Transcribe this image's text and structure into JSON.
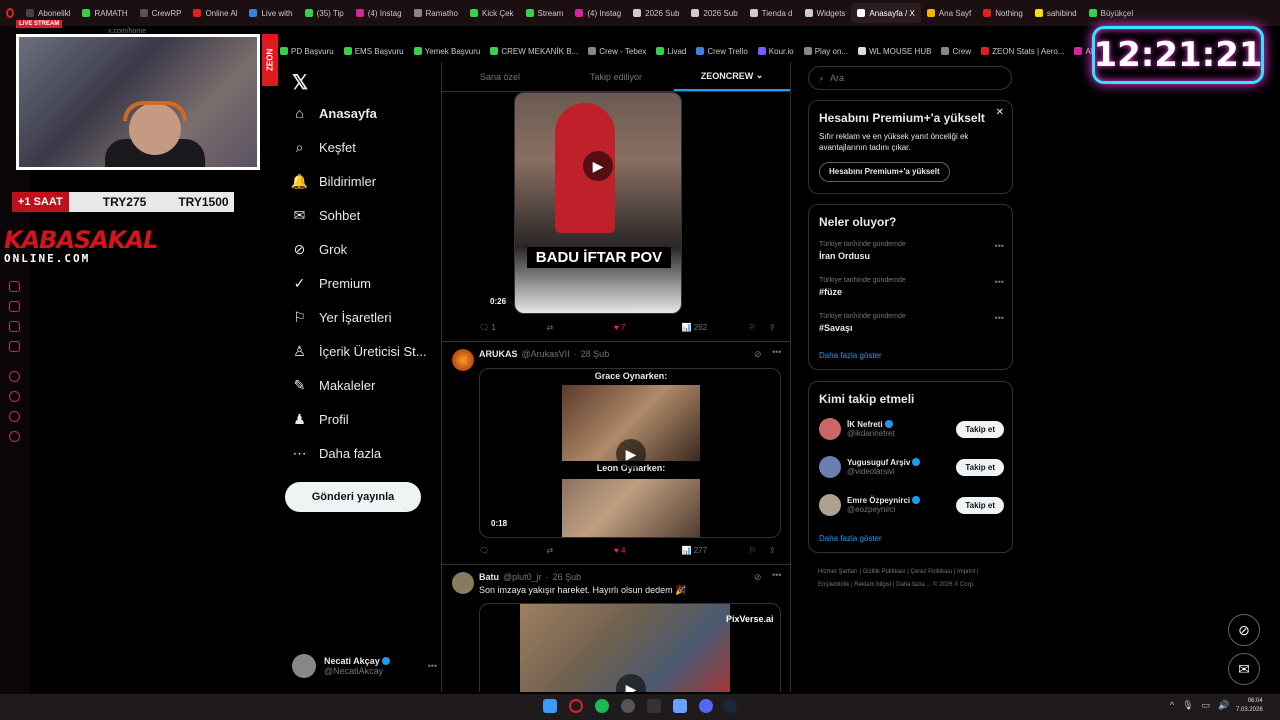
{
  "browser": {
    "tabs": [
      {
        "label": "Abonelikl",
        "color": "#444"
      },
      {
        "label": "RAMATH",
        "color": "#3ad14a"
      },
      {
        "label": "CrewRP",
        "color": "#555"
      },
      {
        "label": "Online Al",
        "color": "#e02020"
      },
      {
        "label": "Live with",
        "color": "#3f7fe0"
      },
      {
        "label": "(35) Tip",
        "color": "#3ad14a"
      },
      {
        "label": "(4) Instag",
        "color": "#d6249f"
      },
      {
        "label": "Ramatho",
        "color": "#888"
      },
      {
        "label": "Kick Çek",
        "color": "#3ad14a"
      },
      {
        "label": "Stream",
        "color": "#3ad14a"
      },
      {
        "label": "(4) Instag",
        "color": "#d6249f"
      },
      {
        "label": "2026 Sub",
        "color": "#ccc"
      },
      {
        "label": "2026 Sub",
        "color": "#ccc"
      },
      {
        "label": "Tienda d",
        "color": "#ccc"
      },
      {
        "label": "Widgets",
        "color": "#ccc"
      },
      {
        "label": "Anasayfa / X",
        "color": "#fff",
        "active": true
      },
      {
        "label": "Ana Sayf",
        "color": "#f5b400"
      },
      {
        "label": "Nothing",
        "color": "#e02020"
      },
      {
        "label": "sahibind",
        "color": "#f5e000"
      },
      {
        "label": "Büyükçel",
        "color": "#3ad14a"
      }
    ],
    "url": "x.com/home",
    "bookmarks": [
      {
        "label": "PD Başvuru",
        "color": "#3ad14a"
      },
      {
        "label": "EMS Başvuru",
        "color": "#3ad14a"
      },
      {
        "label": "Yemek Başvuru",
        "color": "#3ad14a"
      },
      {
        "label": "CREW MEKANİK B...",
        "color": "#3ad14a"
      },
      {
        "label": "Crew - Tebex",
        "color": "#888"
      },
      {
        "label": "Livad",
        "color": "#3ad14a"
      },
      {
        "label": "Crew Trello",
        "color": "#3f7fe0"
      },
      {
        "label": "Kour.io",
        "color": "#7b5cff"
      },
      {
        "label": "Play on...",
        "color": "#888"
      },
      {
        "label": "WL MOUSE HUB",
        "color": "#ddd"
      },
      {
        "label": "Crew",
        "color": "#888"
      },
      {
        "label": "ZEON Stats | Aero...",
        "color": "#e02020"
      },
      {
        "label": "APIq",
        "color": "#d6249f"
      }
    ]
  },
  "overlay": {
    "clock": "12:21:21",
    "live_badge": "LIVE STREAM",
    "zeon_label": "ZEON",
    "donation": {
      "time": "+1 SAAT",
      "price1": "TRY275",
      "price2": "TRY1500"
    },
    "brand_top": "KABASAKAL",
    "brand_bottom": "ONLINE.COM"
  },
  "nav": {
    "items": [
      {
        "label": "Anasayfa",
        "icon": "home-icon",
        "glyph": "⌂"
      },
      {
        "label": "Keşfet",
        "icon": "search-icon",
        "glyph": "⌕"
      },
      {
        "label": "Bildirimler",
        "icon": "bell-icon",
        "glyph": "🔔"
      },
      {
        "label": "Sohbet",
        "icon": "mail-icon",
        "glyph": "✉"
      },
      {
        "label": "Grok",
        "icon": "grok-icon",
        "glyph": "⊘"
      },
      {
        "label": "Premium",
        "icon": "premium-icon",
        "glyph": "✓"
      },
      {
        "label": "Yer İşaretleri",
        "icon": "bookmark-icon",
        "glyph": "⚐"
      },
      {
        "label": "İçerik Üreticisi St...",
        "icon": "creator-icon",
        "glyph": "♙"
      },
      {
        "label": "Makaleler",
        "icon": "article-icon",
        "glyph": "✎"
      },
      {
        "label": "Profil",
        "icon": "profile-icon",
        "glyph": "♟"
      },
      {
        "label": "Daha fazla",
        "icon": "more-icon",
        "glyph": "⋯"
      }
    ],
    "post_button": "Gönderi yayınla",
    "account": {
      "name": "Necati Akçay",
      "handle": "@NecatiAkcay"
    }
  },
  "timeline": {
    "tabs": [
      "Sana özel",
      "Takip ediliyor",
      "ZEONCREW"
    ],
    "posts": [
      {
        "caption": "BADU İFTAR POV",
        "duration": "0:26",
        "replies": "1",
        "reposts": "",
        "likes": "7",
        "views": "262"
      },
      {
        "name": "ARUKAS",
        "handle": "@ArukasVII",
        "date": "28 Şub",
        "top_text": "Grace Oynarken:",
        "bottom_text": "Leon Oynarken:",
        "duration": "0:18",
        "replies": "",
        "reposts": "",
        "likes": "4",
        "views": "277"
      },
      {
        "name": "Batu",
        "handle": "@plut0_jr",
        "date": "26 Şub",
        "text": "Son imzaya yakışır hareket. Hayırlı olsun dedem 🎉",
        "watermark": "PixVerse.ai"
      }
    ]
  },
  "sidebar": {
    "search_placeholder": "Ara",
    "premium": {
      "title": "Hesabını Premium+'a yükselt",
      "body": "Sıfır reklam ve en yüksek yanıt önceliği ek avantajlarının tadını çıkar.",
      "button": "Hesabını Premium+'a yükselt"
    },
    "trends": {
      "title": "Neler oluyor?",
      "items": [
        {
          "context": "Türkiye tarihinde gündemde",
          "name": "İran Ordusu"
        },
        {
          "context": "Türkiye tarihinde gündemde",
          "name": "#füze"
        },
        {
          "context": "Türkiye tarihinde gündemde",
          "name": "#Savaşı"
        }
      ],
      "more": "Daha fazla göster"
    },
    "who": {
      "title": "Kimi takip etmeli",
      "items": [
        {
          "name": "İK Nefreti",
          "handle": "@ikdannefret",
          "button": "Takip et",
          "color": "#c66"
        },
        {
          "name": "Yugusuguf Arşiv",
          "handle": "@videolarsivi",
          "button": "Takip et",
          "color": "#6a7fb0"
        },
        {
          "name": "Emre Özpeynirci",
          "handle": "@eozpeynirci",
          "button": "Takip et",
          "color": "#b0a090"
        }
      ],
      "more": "Daha fazla göster"
    },
    "footer": "Hizmet Şartları | Gizlilik Politikası | Çerez Politikası | Imprint | Erişilebilirlik | Reklam bilgisi | Daha fazla ... © 2026 X Corp."
  },
  "taskbar": {
    "time": "06:04",
    "date": "7.03.2026"
  }
}
